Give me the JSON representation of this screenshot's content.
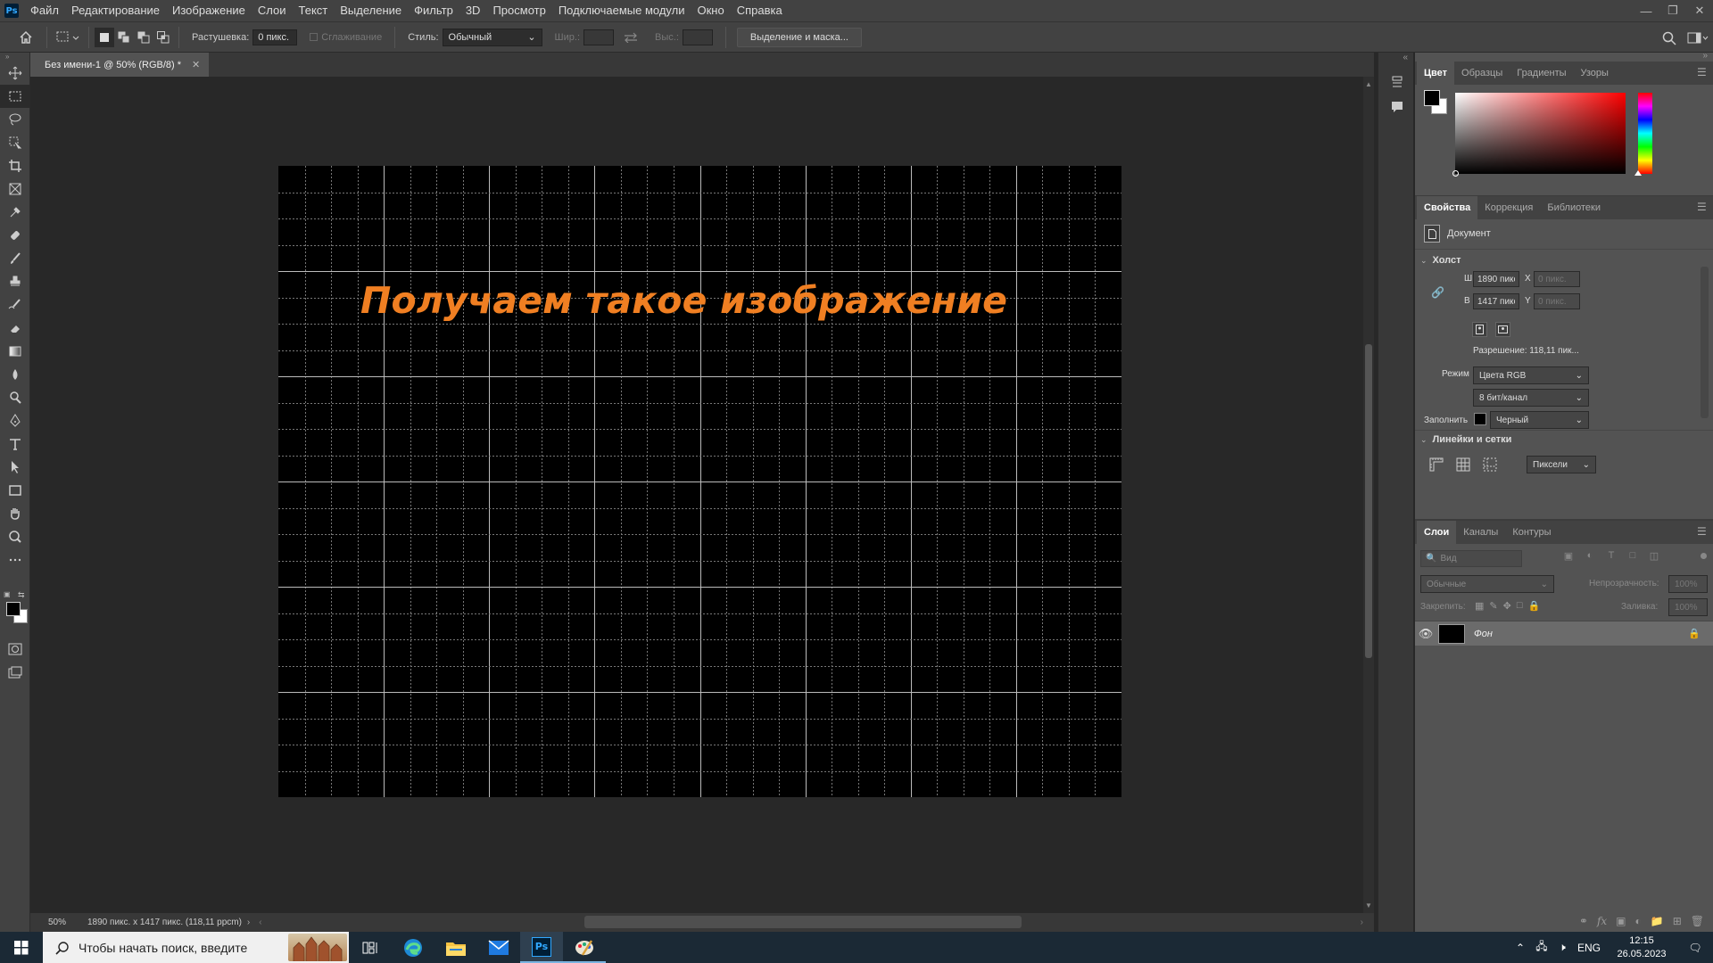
{
  "app": {
    "logo": "Ps"
  },
  "menubar": {
    "items": [
      "Файл",
      "Редактирование",
      "Изображение",
      "Слои",
      "Текст",
      "Выделение",
      "Фильтр",
      "3D",
      "Просмотр",
      "Подключаемые модули",
      "Окно",
      "Справка"
    ]
  },
  "options": {
    "feather_label": "Растушевка:",
    "feather_value": "0 пикс.",
    "antialias_label": "Сглаживание",
    "style_label": "Стиль:",
    "style_value": "Обычный",
    "width_label": "Шир.:",
    "height_label": "Выс.:",
    "mask_button": "Выделение и маска..."
  },
  "document": {
    "tab_title": "Без имени-1 @ 50% (RGB/8) *",
    "canvas_text": "Получаем такое изображение",
    "canvas_text_color": "#f07f22",
    "grid_columns": 32,
    "grid_rows": 24
  },
  "status": {
    "zoom": "50%",
    "info": "1890 пикс. x 1417 пикс. (118,11 ppcm)"
  },
  "color_panel": {
    "tabs": [
      "Цвет",
      "Образцы",
      "Градиенты",
      "Узоры"
    ],
    "hue": "#ff0000"
  },
  "properties_panel": {
    "tabs": [
      "Свойства",
      "Коррекция",
      "Библиотеки"
    ],
    "doc_label": "Документ",
    "canvas_section": "Холст",
    "w_label": "Ш",
    "w_value": "1890 пикс",
    "h_label": "В",
    "h_value": "1417 пикс",
    "x_label": "X",
    "x_placeholder": "0 пикс.",
    "y_label": "Y",
    "y_placeholder": "0 пикс.",
    "resolution": "Разрешение: 118,11 пик...",
    "mode_label": "Режим",
    "mode_value": "Цвета RGB",
    "depth_value": "8 бит/канал",
    "fill_label": "Заполнить",
    "fill_value": "Черный",
    "rulers_section": "Линейки и сетки",
    "units_value": "Пиксели"
  },
  "layers_panel": {
    "tabs": [
      "Слои",
      "Каналы",
      "Контуры"
    ],
    "filter_placeholder": "Вид",
    "blend_mode": "Обычные",
    "opacity_label": "Непрозрачность:",
    "opacity_value": "100%",
    "lock_label": "Закрепить:",
    "fill_label": "Заливка:",
    "fill_value": "100%",
    "layers": [
      {
        "name": "Фон"
      }
    ]
  },
  "taskbar": {
    "search_placeholder": "Чтобы начать поиск, введите",
    "lang": "ENG",
    "time": "12:15",
    "date": "26.05.2023"
  }
}
